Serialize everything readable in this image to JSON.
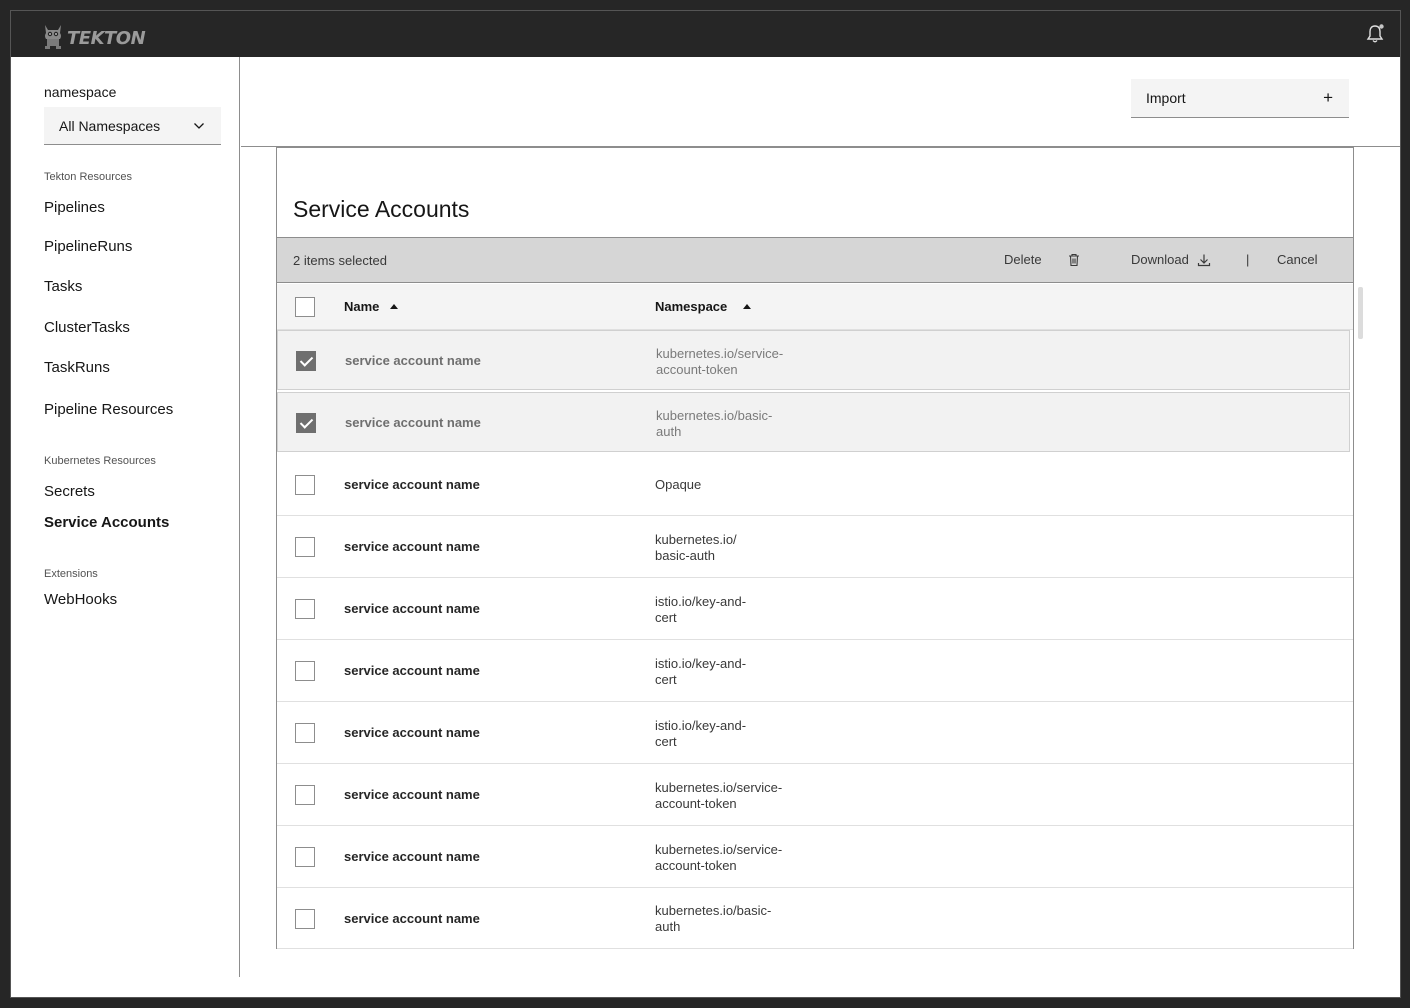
{
  "header": {
    "brand": "TEKTON",
    "logo_icon": "tekton-cat-icon",
    "notification_icon": "bell-icon"
  },
  "sidebar": {
    "namespace_label": "namespace",
    "namespace_selected": "All Namespaces",
    "groups": [
      {
        "label": "Tekton Resources",
        "items": [
          "Pipelines",
          "PipelineRuns",
          "Tasks",
          "ClusterTasks",
          "TaskRuns",
          "Pipeline Resources"
        ]
      },
      {
        "label": "Kubernetes Resources",
        "items": [
          "Secrets",
          "Service Accounts"
        ]
      },
      {
        "label": "Extensions",
        "items": [
          "WebHooks"
        ]
      }
    ],
    "active_item": "Service Accounts"
  },
  "toolbar": {
    "import_label": "Import",
    "import_icon": "plus-icon"
  },
  "table": {
    "title": "Service Accounts",
    "batch": {
      "selected_text": "2 items selected",
      "delete_label": "Delete",
      "download_label": "Download",
      "separator": "|",
      "cancel_label": "Cancel"
    },
    "columns": [
      "Name",
      "Namespace"
    ],
    "rows": [
      {
        "name": "service account name",
        "namespace": [
          "kubernetes.io/service-",
          "account-token"
        ],
        "selected": true
      },
      {
        "name": "service account name",
        "namespace": [
          "kubernetes.io/basic-",
          "auth"
        ],
        "selected": true
      },
      {
        "name": "service account name",
        "namespace": [
          "Opaque"
        ],
        "selected": false
      },
      {
        "name": "service account name",
        "namespace": [
          "kubernetes.io/",
          "basic-auth"
        ],
        "selected": false
      },
      {
        "name": "service account name",
        "namespace": [
          "istio.io/key-and-",
          "cert"
        ],
        "selected": false
      },
      {
        "name": "service account name",
        "namespace": [
          "istio.io/key-and-",
          "cert"
        ],
        "selected": false
      },
      {
        "name": "service account name",
        "namespace": [
          "istio.io/key-and-",
          "cert"
        ],
        "selected": false
      },
      {
        "name": "service account name",
        "namespace": [
          "kubernetes.io/service-",
          "account-token"
        ],
        "selected": false
      },
      {
        "name": "service account name",
        "namespace": [
          "kubernetes.io/service-",
          "account-token"
        ],
        "selected": false
      },
      {
        "name": "service account name",
        "namespace": [
          "kubernetes.io/basic-",
          "auth"
        ],
        "selected": false
      }
    ]
  }
}
